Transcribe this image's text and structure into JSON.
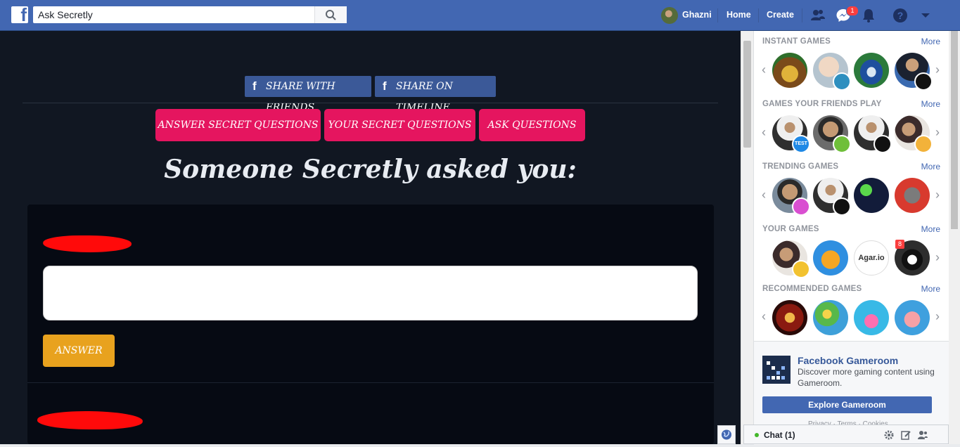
{
  "topbar": {
    "search_value": "Ask Secretly",
    "user_name": "Ghazni",
    "home": "Home",
    "create": "Create",
    "messenger_badge": "1"
  },
  "app": {
    "share_friends": "SHARE WITH FRIENDS",
    "share_timeline": "SHARE ON TIMELINE",
    "btn_answer_secret": "ANSWER SECRET QUESTIONS",
    "btn_your_secret": "YOUR SECRET QUESTIONS",
    "btn_ask": "ASK QUESTIONS",
    "headline": "Someone Secretly asked you:",
    "answer_button": "ANSWER"
  },
  "games": {
    "more": "More",
    "sections": [
      {
        "title": "INSTANT GAMES"
      },
      {
        "title": "GAMES YOUR FRIENDS PLAY"
      },
      {
        "title": "TRENDING GAMES"
      },
      {
        "title": "YOUR GAMES"
      },
      {
        "title": "RECOMMENDED GAMES"
      }
    ],
    "test_label": "TEST",
    "agar_label": "Agar.io",
    "pool_badge": "8"
  },
  "gameroom": {
    "title": "Facebook Gameroom",
    "desc": "Discover more gaming content using Gameroom.",
    "button": "Explore Gameroom",
    "links": "Privacy · Terms · Cookies"
  },
  "chat": {
    "label": "Chat (1)"
  },
  "colors": {
    "fb_blue": "#4267b2",
    "pink": "#e5155f",
    "gold": "#e8a21e",
    "dark_bg": "#111722"
  }
}
